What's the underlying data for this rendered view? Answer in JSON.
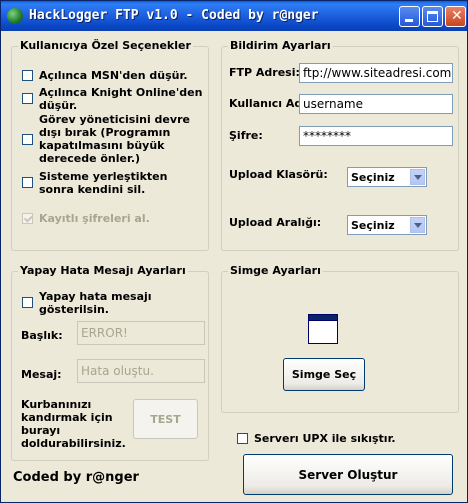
{
  "window": {
    "title": "HackLogger FTP v1.0 - Coded by r@nger"
  },
  "user_options": {
    "legend": "Kullanıcıya Özel Seçenekler",
    "opt1": "Açılınca MSN'den düşür.",
    "opt2_l1": "Açılınca Knight Online'den",
    "opt2_l2": "düşür.",
    "opt3_l1": "Görev yöneticisini devre",
    "opt3_l2": "dışı bırak (Programın",
    "opt3_l3": "kapatılmasını büyük",
    "opt3_l4": "derecede önler.)",
    "opt4_l1": "Sisteme yerleştikten",
    "opt4_l2": "sonra kendini sil.",
    "opt5": "Kayıtlı şifreleri al."
  },
  "notify": {
    "legend": "Bildirim Ayarları",
    "ftp_label": "FTP Adresi:",
    "ftp_value": "ftp://www.siteadresi.com",
    "user_label": "Kullanıcı Adı:",
    "user_value": "username",
    "pass_label": "Şifre:",
    "pass_value": "********",
    "folder_label": "Upload Klasörü:",
    "folder_value": "Seçiniz",
    "interval_label": "Upload Aralığı:",
    "interval_value": "Seçiniz"
  },
  "fake_error": {
    "legend": "Yapay Hata Mesajı Ayarları",
    "show_l1": "Yapay hata mesajı",
    "show_l2": "gösterilsin.",
    "title_label": "Başlık:",
    "title_value": "ERROR!",
    "msg_label": "Mesaj:",
    "msg_value": "Hata oluştu.",
    "hint_l1": "Kurbanınızı",
    "hint_l2": "kandırmak için",
    "hint_l3": "burayı",
    "hint_l4": "doldurabilirsiniz.",
    "test_label": "TEST"
  },
  "icon": {
    "legend": "Simge Ayarları",
    "choose_label": "Simge Seç"
  },
  "upx_label": "Serverı UPX ile sıkıştır.",
  "build_label": "Server Oluştur",
  "footer": "Coded by r@nger"
}
